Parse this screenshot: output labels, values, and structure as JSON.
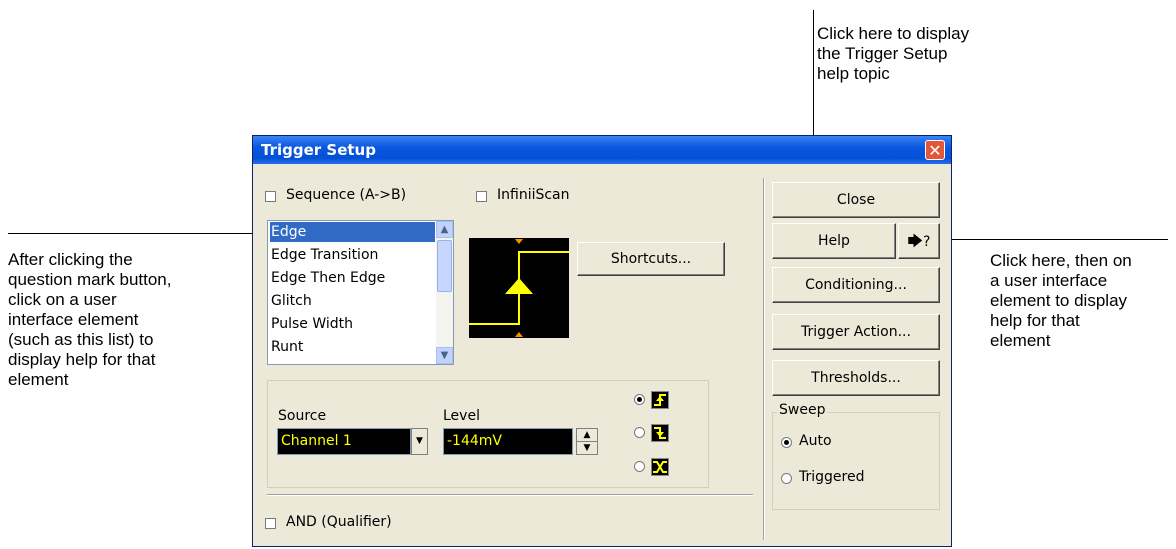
{
  "callouts": {
    "help_topic": "Click here to display\nthe Trigger Setup\nhelp topic",
    "question_mark": "Click here, then on\na user interface\nelement to display\nhelp for that\nelement",
    "list_help": "After clicking the\nquestion mark button,\nclick on a user\ninterface element\n(such as this list) to\ndisplay  help for that\nelement"
  },
  "dialog": {
    "title": "Trigger Setup",
    "close_glyph": "✕",
    "sequence_label": "Sequence (A->B)",
    "infiniiscan_label": "InfiniiScan",
    "trigger_types": [
      "Edge",
      "Edge Transition",
      "Edge Then Edge",
      "Glitch",
      "Pulse Width",
      "Runt"
    ],
    "selected_type": "Edge",
    "shortcuts_label": "Shortcuts...",
    "source_label": "Source",
    "source_value": "Channel 1",
    "level_label": "Level",
    "level_value": "-144mV",
    "edge_options": [
      "rising-edge-icon",
      "falling-edge-icon",
      "either-edge-icon"
    ],
    "edge_selected_index": 0,
    "and_qualifier_label": "AND (Qualifier)",
    "buttons": {
      "close": "Close",
      "help": "Help",
      "whats_this": "?",
      "conditioning": "Conditioning...",
      "trigger_action": "Trigger Action...",
      "thresholds": "Thresholds..."
    },
    "sweep": {
      "legend": "Sweep",
      "options": [
        "Auto",
        "Triggered"
      ],
      "selected": "Auto"
    }
  }
}
